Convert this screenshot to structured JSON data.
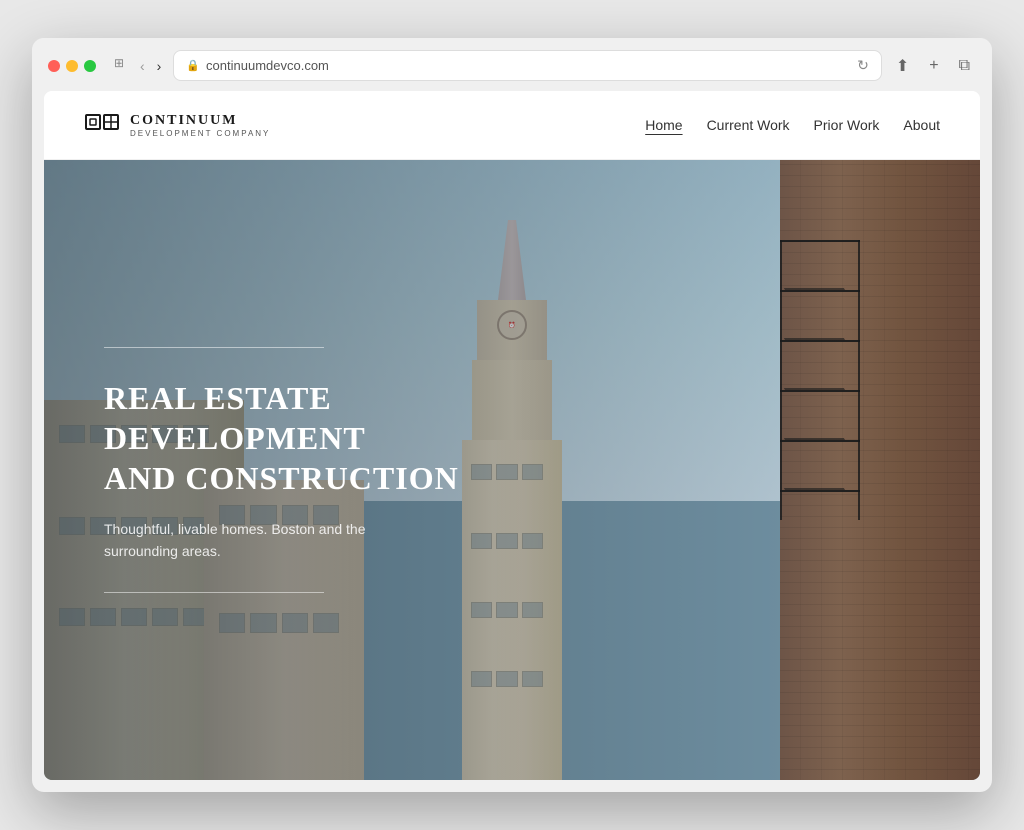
{
  "browser": {
    "url": "continuumdevco.com",
    "back_btn": "‹",
    "forward_btn": "›",
    "reload_btn": "↻",
    "share_btn": "⬆",
    "new_tab_btn": "+",
    "duplicate_btn": "⧉"
  },
  "site": {
    "logo_name": "CONTINUUM",
    "logo_sub": "DEVELOPMENT COMPANY",
    "nav": {
      "home": "Home",
      "current_work": "Current Work",
      "prior_work": "Prior Work",
      "about": "About"
    },
    "hero": {
      "title_line1": "REAL ESTATE",
      "title_line2": "DEVELOPMENT",
      "title_line3": "AND CONSTRUCTION",
      "subtitle": "Thoughtful, livable homes. Boston and the surrounding areas."
    }
  }
}
